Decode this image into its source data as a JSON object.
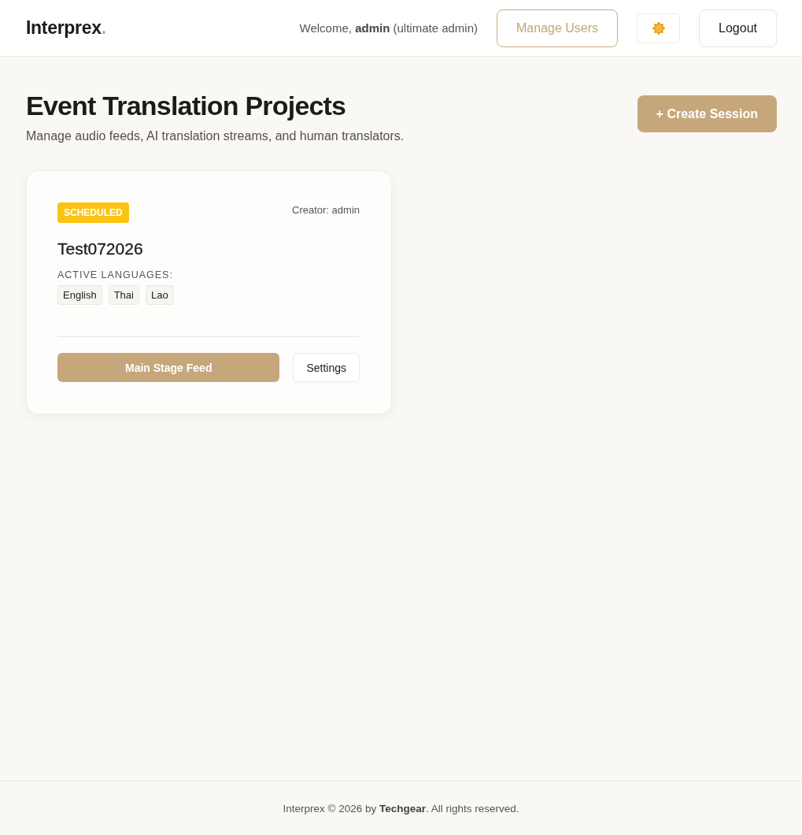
{
  "header": {
    "brand": {
      "name": "Interprex",
      "mark": "."
    },
    "welcome": "Welcome, **admin** (ultimate admin)",
    "buttons": [
      {
        "kind": "outline",
        "label": "Manage Users"
      },
      {
        "kind": "theme"
      },
      {
        "kind": "plain",
        "label": "Logout"
      }
    ]
  },
  "page": {
    "title": "Event Translation Projects",
    "subtitle": "Manage audio feeds, AI translation streams, and human translators.",
    "create_button": "+ Create Session"
  },
  "sessions": [
    {
      "status": {
        "kind": "scheduled",
        "label": "SCHEDULED"
      },
      "creator": "Creator: admin",
      "name": "Test072026",
      "languages_label": "ACTIVE LANGUAGES:",
      "languages": [
        "English",
        "Thai",
        "Lao"
      ],
      "primary_action": "Main Stage Feed",
      "secondary_action": "Settings"
    }
  ],
  "footer": "Interprex © 2026 by **Techgear**. All rights reserved."
}
